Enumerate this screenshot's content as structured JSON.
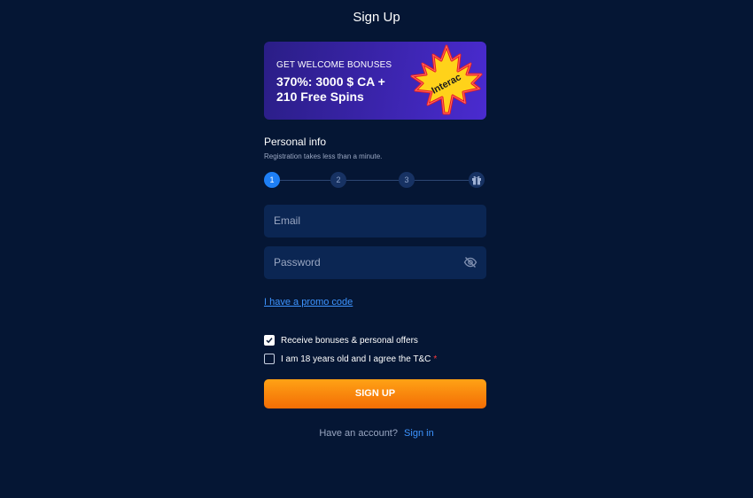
{
  "page": {
    "title": "Sign Up"
  },
  "banner": {
    "kicker": "GET WELCOME BONUSES",
    "headline": "370%: 3000 $ CA + 210 Free Spins",
    "logo_text": "Interac"
  },
  "personal_info": {
    "title": "Personal info",
    "subtitle": "Registration takes less than a minute."
  },
  "stepper": {
    "steps": [
      "1",
      "2",
      "3"
    ],
    "active_step": 1,
    "final_icon": "gift-icon"
  },
  "form": {
    "email_placeholder": "Email",
    "password_placeholder": "Password",
    "password_toggle_icon": "eye-off-icon",
    "promo_link": "I have a promo code",
    "bonuses_checkbox": {
      "label": "Receive bonuses & personal offers",
      "checked": true
    },
    "terms_checkbox": {
      "label": "I am 18 years old and I agree the T&C",
      "required_mark": "*",
      "checked": false
    },
    "submit_label": "SIGN UP"
  },
  "footer": {
    "prompt": "Have an account?",
    "link": "Sign in"
  },
  "colors": {
    "background": "#051634",
    "field": "#0b2653",
    "accent_blue": "#1e7ff5",
    "link": "#3d94ff",
    "cta_top": "#ffa215",
    "cta_bottom": "#f36d05"
  }
}
